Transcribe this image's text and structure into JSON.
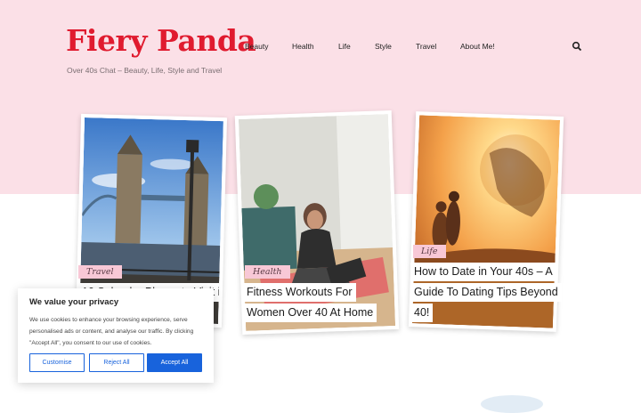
{
  "site": {
    "logo": "Fiery Panda",
    "tagline": "Over 40s Chat – Beauty, Life, Style and Travel"
  },
  "nav": {
    "items": [
      {
        "label": "Beauty"
      },
      {
        "label": "Health"
      },
      {
        "label": "Life"
      },
      {
        "label": "Style"
      },
      {
        "label": "Travel"
      },
      {
        "label": "About Me!"
      }
    ]
  },
  "cards": [
    {
      "category": "Travel",
      "title_lines": [
        "10 Splendor Places to Visit in"
      ]
    },
    {
      "category": "Health",
      "title_lines": [
        "Fitness Workouts For",
        "Women Over 40 At Home"
      ]
    },
    {
      "category": "Life",
      "title_lines": [
        "How to Date in Your 40s – A",
        "Guide To Dating Tips Beyond",
        "40!"
      ]
    }
  ],
  "cookie_banner": {
    "title": "We value your privacy",
    "text": "We use cookies to enhance your browsing experience, serve personalised ads or content, and analyse our traffic. By clicking \"Accept All\", you consent to our use of cookies.",
    "buttons": {
      "customise": "Customise",
      "reject": "Reject All",
      "accept": "Accept All"
    }
  },
  "colors": {
    "brand_red": "#e01b2f",
    "header_pink": "#fbe0e7",
    "tag_pink": "#f8c8d6",
    "button_blue": "#1863dc"
  }
}
